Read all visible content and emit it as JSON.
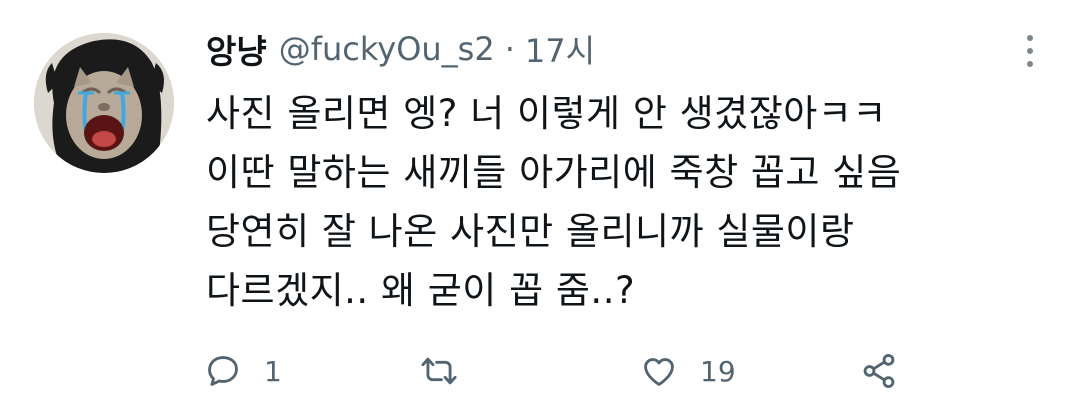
{
  "author": {
    "display_name": "앙냥",
    "handle": "@fuckyOu_s2",
    "separator": "·",
    "time": "17시"
  },
  "tweet": {
    "lines": [
      "사진 올리면 엥? 너 이렇게 안 생겼잖아ㅋㅋ",
      "이딴 말하는 새끼들 아가리에 죽창 꼽고 싶음",
      "당연히 잘 나온 사진만 올리니까 실물이랑",
      "다르겠지.. 왜 굳이 꼽 줌..?"
    ]
  },
  "actions": {
    "reply": {
      "icon": "reply-icon",
      "count": "1"
    },
    "retweet": {
      "icon": "retweet-icon",
      "count": ""
    },
    "like": {
      "icon": "heart-icon",
      "count": "19"
    },
    "share": {
      "icon": "share-icon"
    }
  },
  "colors": {
    "text": "#0f1419",
    "secondary": "#536471",
    "icon": "#536471",
    "background": "#ffffff"
  }
}
